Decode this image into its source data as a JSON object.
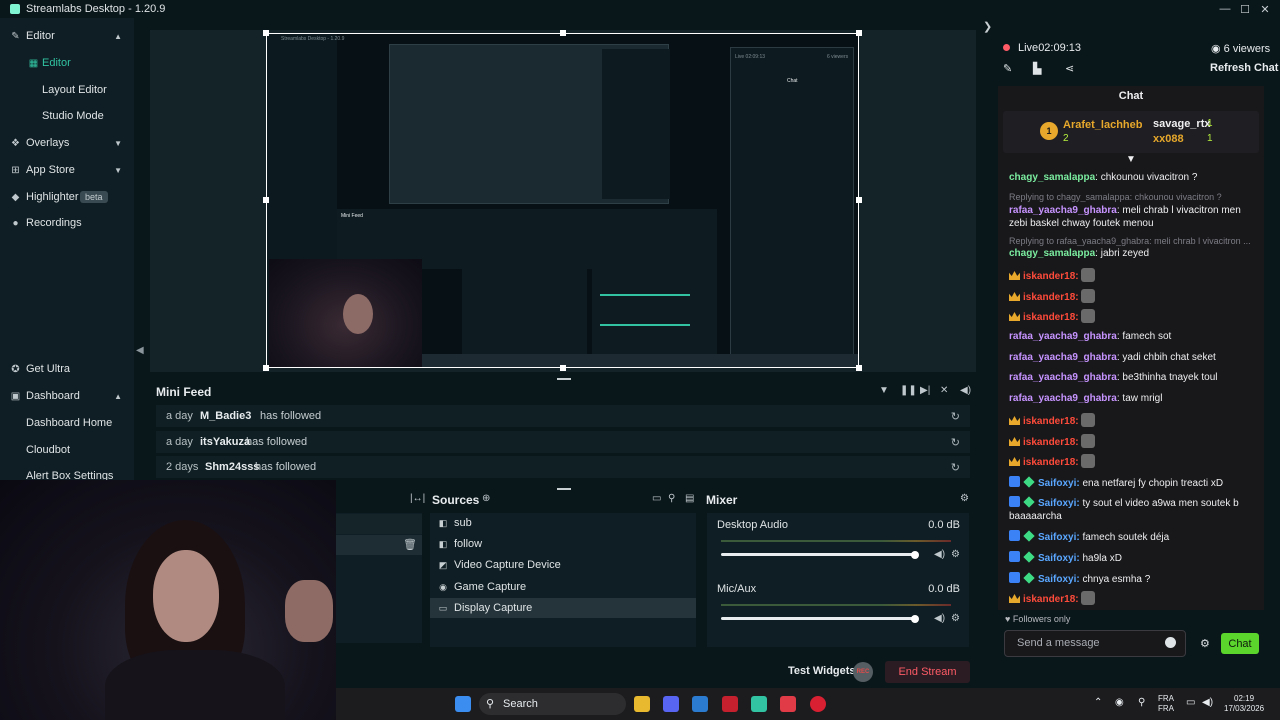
{
  "window": {
    "title": "Streamlabs Desktop - 1.20.9",
    "minimize": "—",
    "maximize": "☐",
    "close": "✕"
  },
  "sidebar": {
    "items": [
      {
        "label": "Editor",
        "icon": "edit-icon",
        "expanded": true
      },
      {
        "label": "Editor",
        "icon": "layout-icon",
        "active": true
      },
      {
        "label": "Layout Editor"
      },
      {
        "label": "Studio Mode"
      },
      {
        "label": "Overlays",
        "icon": "overlays-icon"
      },
      {
        "label": "App Store",
        "icon": "app-store-icon"
      },
      {
        "label": "Highlighter",
        "icon": "highlighter-icon",
        "badge": "beta"
      },
      {
        "label": "Recordings",
        "icon": "recordings-icon"
      },
      {
        "label": "Get Ultra",
        "icon": "ultra-icon"
      },
      {
        "label": "Dashboard",
        "icon": "dashboard-icon"
      },
      {
        "label": "Dashboard Home"
      },
      {
        "label": "Cloudbot"
      },
      {
        "label": "Alert Box Settings"
      }
    ]
  },
  "minifeed": {
    "title": "Mini Feed",
    "rows": [
      {
        "when": "a day",
        "who": "M_Badie3",
        "action": "has followed"
      },
      {
        "when": "a day",
        "who": "itsYakuza",
        "action": "has followed"
      },
      {
        "when": "2 days",
        "who": "Shm24sss",
        "action": "has followed"
      }
    ]
  },
  "sources": {
    "title": "Sources",
    "items": [
      {
        "label": "sub"
      },
      {
        "label": "follow"
      },
      {
        "label": "Video Capture Device"
      },
      {
        "label": "Game Capture"
      },
      {
        "label": "Display Capture",
        "selected": true
      }
    ]
  },
  "mixer": {
    "title": "Mixer",
    "channels": [
      {
        "name": "Desktop Audio",
        "db": "0.0 dB"
      },
      {
        "name": "Mic/Aux",
        "db": "0.0 dB"
      }
    ]
  },
  "controls": {
    "test_widgets": "Test Widgets",
    "rec": "REC",
    "end_stream": "End Stream"
  },
  "live": {
    "status": "Live",
    "time": "02:09:13",
    "viewers": "6 viewers",
    "refresh": "Refresh Chat"
  },
  "chat": {
    "header": "Chat",
    "pinned": {
      "rank": "1",
      "user1": "Arafet_lachheb",
      "user1_count": "2",
      "user2": "savage_rtx",
      "user2_count": "1",
      "user3": "xx088",
      "user3_count": "1"
    },
    "msg1_user": "chagy_samalappa",
    "msg1_text": "chkounou vivacitron ?",
    "reply1": "Replying to chagy_samalappa: chkounou vivacitron ?",
    "msg2_user": "rafaa_yaacha9_ghabra",
    "msg2_text": "meli chrab l vivacitron men zebi baskel chway foutek menou",
    "reply2": "Replying to rafaa_yaacha9_ghabra: meli chrab l vivacitron ...",
    "msg3_user": "chagy_samalappa",
    "msg3_text": "jabri zeyed",
    "iskander": "iskander18:",
    "msg4_text": "famech sot",
    "msg5_text": "yadi chbih chat seket",
    "msg6_text": "be3thinha tnayek toul",
    "msg7_text": "taw mrigl",
    "saif_user": "Saifoxyi:",
    "saif1": "ena netfarej fy chopin treacti xD",
    "saif2": "ty sout el video a9wa men soutek b baaaaarcha",
    "saif3": "famech soutek déja",
    "saif4": "ha9la xD",
    "saif5": "chnya esmha ?",
    "followers_only": "Followers only",
    "placeholder": "Send a message",
    "send": "Chat"
  },
  "taskbar": {
    "search": "Search",
    "lang": "FRA",
    "lang2": "FRA",
    "time": "02:19",
    "date": "17/03/2026"
  },
  "preview": {
    "mini_title": "Streamlabs Desktop - 1.20.9",
    "mini_feed": "Mini Feed",
    "mini_chat": "Chat",
    "mini_live": "Live 02:09:13",
    "mini_viewers": "6 viewers"
  }
}
